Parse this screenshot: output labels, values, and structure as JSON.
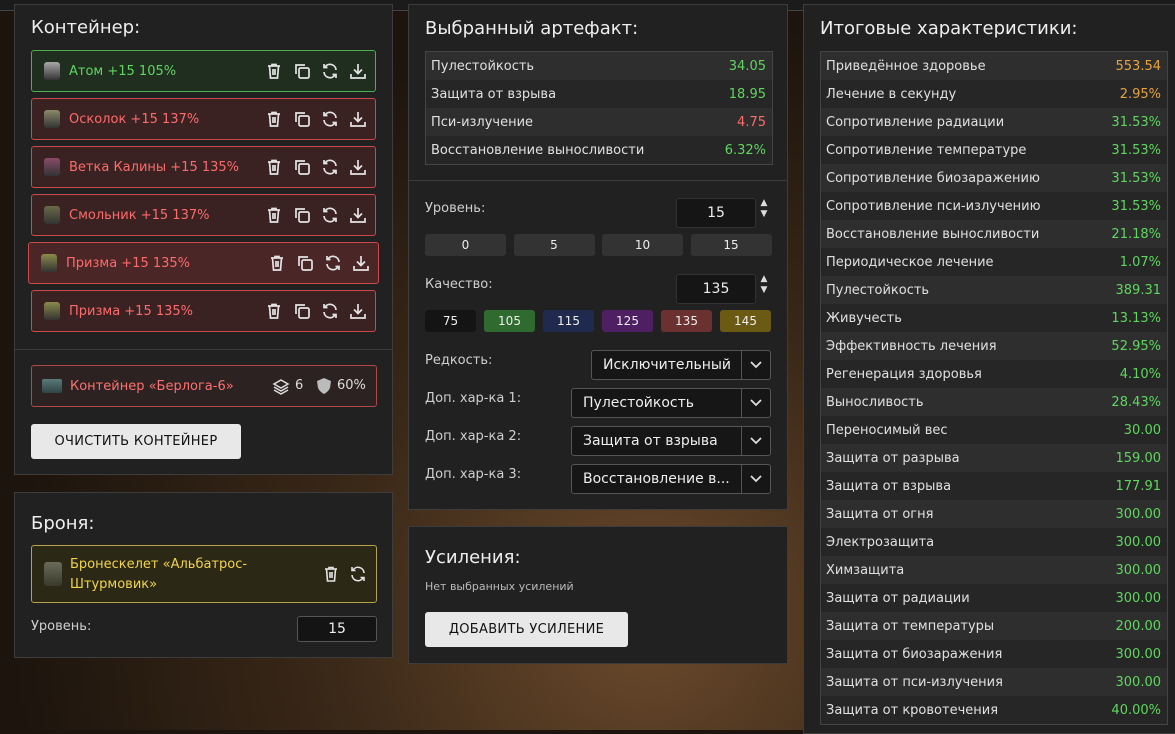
{
  "container": {
    "title": "Контейнер:",
    "artifacts": [
      {
        "label": "Атом +15 105%",
        "state": "green"
      },
      {
        "label": "Осколок +15 137%",
        "state": "red"
      },
      {
        "label": "Ветка Калины +15 135%",
        "state": "red"
      },
      {
        "label": "Смольник +15 137%",
        "state": "red"
      },
      {
        "label": "Призма +15 135%",
        "state": "selected"
      },
      {
        "label": "Призма +15 135%",
        "state": "red"
      }
    ],
    "box": {
      "label": "Контейнер «Берлога-6»",
      "slots": "6",
      "protection": "60%"
    },
    "clear_button": "ОЧИСТИТЬ КОНТЕЙНЕР"
  },
  "armor": {
    "title": "Броня:",
    "name": "Бронескелет «Альбатрос-Штурмовик»",
    "level_label": "Уровень:",
    "level_value": "15"
  },
  "selected_artifact": {
    "title": "Выбранный артефакт:",
    "stats": [
      {
        "k": "Пулестойкость",
        "v": "34.05",
        "color": "green"
      },
      {
        "k": "Защита от взрыва",
        "v": "18.95",
        "color": "green"
      },
      {
        "k": "Пси-излучение",
        "v": "4.75",
        "color": "red"
      },
      {
        "k": "Восстановление выносливости",
        "v": "6.32%",
        "color": "green"
      }
    ],
    "level_label": "Уровень:",
    "level_value": "15",
    "level_presets": [
      "0",
      "5",
      "10",
      "15"
    ],
    "quality_label": "Качество:",
    "quality_value": "135",
    "quality_presets": [
      {
        "v": "75",
        "color": "#141414"
      },
      {
        "v": "105",
        "color": "#2f6b2f"
      },
      {
        "v": "115",
        "color": "#1f2a4e"
      },
      {
        "v": "125",
        "color": "#4f1f63"
      },
      {
        "v": "135",
        "color": "#6b3030"
      },
      {
        "v": "145",
        "color": "#6b5a14"
      }
    ],
    "rarity_label": "Редкость:",
    "rarity_value": "Исключительный",
    "extra1_label": "Доп. хар-ка 1:",
    "extra1_value": "Пулестойкость",
    "extra2_label": "Доп. хар-ка 2:",
    "extra2_value": "Защита от взрыва",
    "extra3_label": "Доп. хар-ка 3:",
    "extra3_value": "Восстановление в..."
  },
  "boosts": {
    "title": "Усиления:",
    "empty": "Нет выбранных усилений",
    "add_button": "ДОБАВИТЬ УСИЛЕНИЕ"
  },
  "totals": {
    "title": "Итоговые характеристики:",
    "rows": [
      {
        "k": "Приведённое здоровье",
        "v": "553.54",
        "color": "orange"
      },
      {
        "k": "Лечение в секунду",
        "v": "2.95%",
        "color": "orange"
      },
      {
        "k": "Сопротивление радиации",
        "v": "31.53%",
        "color": "green"
      },
      {
        "k": "Сопротивление температуре",
        "v": "31.53%",
        "color": "green"
      },
      {
        "k": "Сопротивление биозаражению",
        "v": "31.53%",
        "color": "green"
      },
      {
        "k": "Сопротивление пси-излучению",
        "v": "31.53%",
        "color": "green"
      },
      {
        "k": "Восстановление выносливости",
        "v": "21.18%",
        "color": "green"
      },
      {
        "k": "Периодическое лечение",
        "v": "1.07%",
        "color": "green"
      },
      {
        "k": "Пулестойкость",
        "v": "389.31",
        "color": "green"
      },
      {
        "k": "Живучесть",
        "v": "13.13%",
        "color": "green"
      },
      {
        "k": "Эффективность лечения",
        "v": "52.95%",
        "color": "green"
      },
      {
        "k": "Регенерация здоровья",
        "v": "4.10%",
        "color": "green"
      },
      {
        "k": "Выносливость",
        "v": "28.43%",
        "color": "green"
      },
      {
        "k": "Переносимый вес",
        "v": "30.00",
        "color": "green"
      },
      {
        "k": "Защита от разрыва",
        "v": "159.00",
        "color": "green"
      },
      {
        "k": "Защита от взрыва",
        "v": "177.91",
        "color": "green"
      },
      {
        "k": "Защита от огня",
        "v": "300.00",
        "color": "green"
      },
      {
        "k": "Электрозащита",
        "v": "300.00",
        "color": "green"
      },
      {
        "k": "Химзащита",
        "v": "300.00",
        "color": "green"
      },
      {
        "k": "Защита от радиации",
        "v": "300.00",
        "color": "green"
      },
      {
        "k": "Защита от температуры",
        "v": "200.00",
        "color": "green"
      },
      {
        "k": "Защита от биозаражения",
        "v": "300.00",
        "color": "green"
      },
      {
        "k": "Защита от пси-излучения",
        "v": "300.00",
        "color": "green"
      },
      {
        "k": "Защита от кровотечения",
        "v": "40.00%",
        "color": "green"
      }
    ]
  }
}
